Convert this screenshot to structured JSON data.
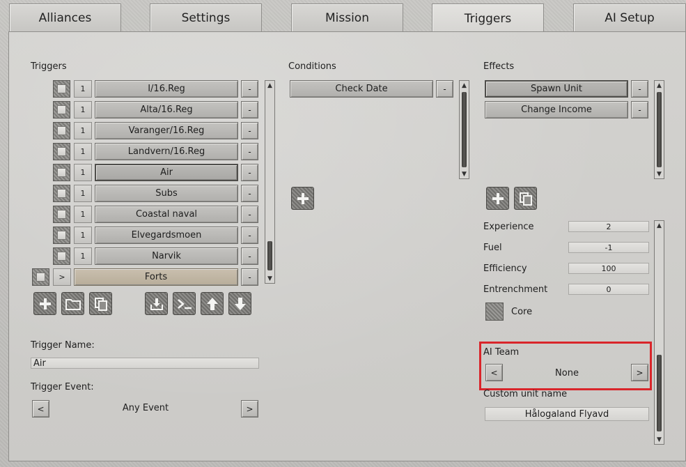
{
  "tabs": [
    {
      "label": "Alliances"
    },
    {
      "label": "Settings"
    },
    {
      "label": "Mission"
    },
    {
      "label": "Triggers"
    },
    {
      "label": "AI Setup"
    }
  ],
  "active_tab": "Triggers",
  "triggers": {
    "heading": "Triggers",
    "items": [
      {
        "count": "1",
        "label": "I/16.Reg",
        "remove": "-"
      },
      {
        "count": "1",
        "label": "Alta/16.Reg",
        "remove": "-"
      },
      {
        "count": "1",
        "label": "Varanger/16.Reg",
        "remove": "-"
      },
      {
        "count": "1",
        "label": "Landvern/16.Reg",
        "remove": "-"
      },
      {
        "count": "1",
        "label": "Air",
        "remove": "-"
      },
      {
        "count": "1",
        "label": "Subs",
        "remove": "-"
      },
      {
        "count": "1",
        "label": "Coastal naval",
        "remove": "-"
      },
      {
        "count": "1",
        "label": "Elvegardsmoen",
        "remove": "-"
      },
      {
        "count": "1",
        "label": "Narvik",
        "remove": "-"
      },
      {
        "count": ">",
        "label": "Forts",
        "remove": "-"
      }
    ],
    "selected": "Air"
  },
  "conditions": {
    "heading": "Conditions",
    "items": [
      {
        "label": "Check Date",
        "remove": "-"
      }
    ]
  },
  "effects": {
    "heading": "Effects",
    "items": [
      {
        "label": "Spawn Unit",
        "remove": "-"
      },
      {
        "label": "Change Income",
        "remove": "-"
      }
    ]
  },
  "effect_params": {
    "experience_label": "Experience",
    "experience_value": "2",
    "fuel_label": "Fuel",
    "fuel_value": "-1",
    "efficiency_label": "Efficiency",
    "efficiency_value": "100",
    "entrenchment_label": "Entrenchment",
    "entrenchment_value": "0",
    "core_label": "Core",
    "ai_team_label": "AI Team",
    "ai_team_value": "None",
    "prev": "<",
    "next": ">",
    "custom_unit_name_label": "Custom unit name",
    "custom_unit_name_value": "Hålogaland Flyavd"
  },
  "trigger_name": {
    "label": "Trigger Name:",
    "value": "Air"
  },
  "trigger_event": {
    "label": "Trigger Event:",
    "value": "Any Event",
    "prev": "<",
    "next": ">"
  },
  "scroll_up": "▲",
  "scroll_down": "▼",
  "colors": {
    "highlight": "#d9252a",
    "panel": "#cfcecb"
  }
}
